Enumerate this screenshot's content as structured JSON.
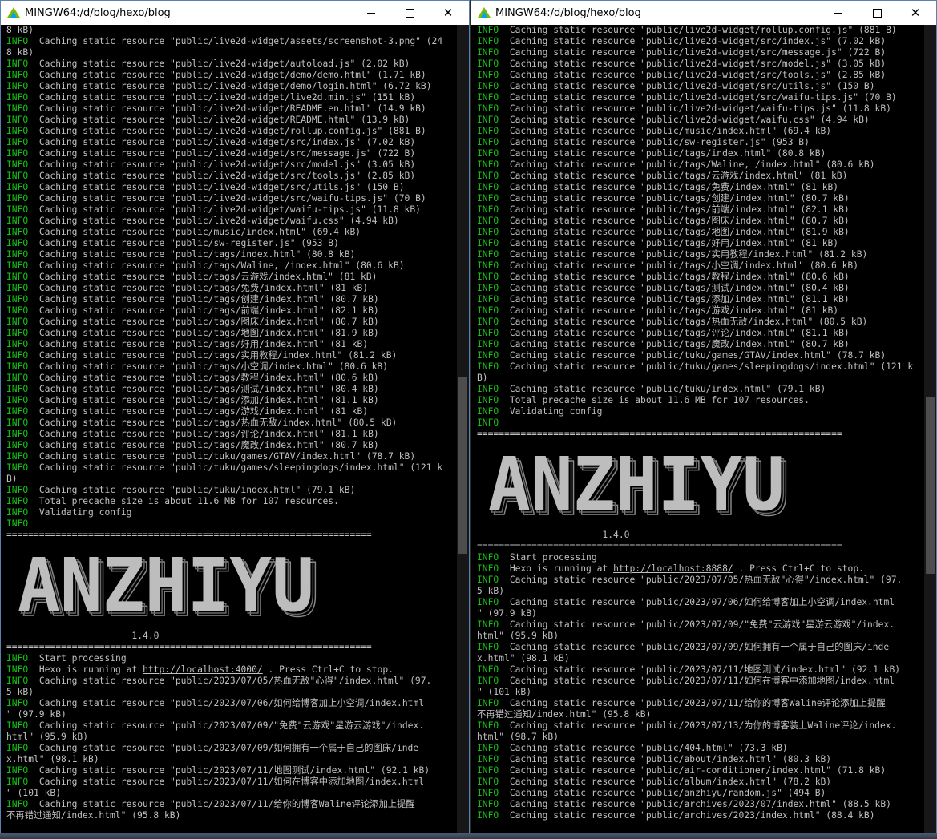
{
  "windows": [
    {
      "title": "MINGW64:/d/blog/hexo/blog",
      "lines": [
        {
          "text": "8 kB)"
        },
        {
          "level": "INFO",
          "text": "Caching static resource \"public/live2d-widget/assets/screenshot-3.png\" (24"
        },
        {
          "text": "8 kB)"
        },
        {
          "level": "INFO",
          "text": "Caching static resource \"public/live2d-widget/autoload.js\" (2.02 kB)"
        },
        {
          "level": "INFO",
          "text": "Caching static resource \"public/live2d-widget/demo/demo.html\" (1.71 kB)"
        },
        {
          "level": "INFO",
          "text": "Caching static resource \"public/live2d-widget/demo/login.html\" (6.72 kB)"
        },
        {
          "level": "INFO",
          "text": "Caching static resource \"public/live2d-widget/live2d.min.js\" (151 kB)"
        },
        {
          "level": "INFO",
          "text": "Caching static resource \"public/live2d-widget/README.en.html\" (14.9 kB)"
        },
        {
          "level": "INFO",
          "text": "Caching static resource \"public/live2d-widget/README.html\" (13.9 kB)"
        },
        {
          "level": "INFO",
          "text": "Caching static resource \"public/live2d-widget/rollup.config.js\" (881 B)"
        },
        {
          "level": "INFO",
          "text": "Caching static resource \"public/live2d-widget/src/index.js\" (7.02 kB)"
        },
        {
          "level": "INFO",
          "text": "Caching static resource \"public/live2d-widget/src/message.js\" (722 B)"
        },
        {
          "level": "INFO",
          "text": "Caching static resource \"public/live2d-widget/src/model.js\" (3.05 kB)"
        },
        {
          "level": "INFO",
          "text": "Caching static resource \"public/live2d-widget/src/tools.js\" (2.85 kB)"
        },
        {
          "level": "INFO",
          "text": "Caching static resource \"public/live2d-widget/src/utils.js\" (150 B)"
        },
        {
          "level": "INFO",
          "text": "Caching static resource \"public/live2d-widget/src/waifu-tips.js\" (70 B)"
        },
        {
          "level": "INFO",
          "text": "Caching static resource \"public/live2d-widget/waifu-tips.js\" (11.8 kB)"
        },
        {
          "level": "INFO",
          "text": "Caching static resource \"public/live2d-widget/waifu.css\" (4.94 kB)"
        },
        {
          "level": "INFO",
          "text": "Caching static resource \"public/music/index.html\" (69.4 kB)"
        },
        {
          "level": "INFO",
          "text": "Caching static resource \"public/sw-register.js\" (953 B)"
        },
        {
          "level": "INFO",
          "text": "Caching static resource \"public/tags/index.html\" (80.8 kB)"
        },
        {
          "level": "INFO",
          "text": "Caching static resource \"public/tags/Waline, /index.html\" (80.6 kB)"
        },
        {
          "level": "INFO",
          "text": "Caching static resource \"public/tags/云游戏/index.html\" (81 kB)"
        },
        {
          "level": "INFO",
          "text": "Caching static resource \"public/tags/免费/index.html\" (81 kB)"
        },
        {
          "level": "INFO",
          "text": "Caching static resource \"public/tags/创建/index.html\" (80.7 kB)"
        },
        {
          "level": "INFO",
          "text": "Caching static resource \"public/tags/前端/index.html\" (82.1 kB)"
        },
        {
          "level": "INFO",
          "text": "Caching static resource \"public/tags/图床/index.html\" (80.7 kB)"
        },
        {
          "level": "INFO",
          "text": "Caching static resource \"public/tags/地图/index.html\" (81.9 kB)"
        },
        {
          "level": "INFO",
          "text": "Caching static resource \"public/tags/好用/index.html\" (81 kB)"
        },
        {
          "level": "INFO",
          "text": "Caching static resource \"public/tags/实用教程/index.html\" (81.2 kB)"
        },
        {
          "level": "INFO",
          "text": "Caching static resource \"public/tags/小空调/index.html\" (80.6 kB)"
        },
        {
          "level": "INFO",
          "text": "Caching static resource \"public/tags/教程/index.html\" (80.6 kB)"
        },
        {
          "level": "INFO",
          "text": "Caching static resource \"public/tags/测试/index.html\" (80.4 kB)"
        },
        {
          "level": "INFO",
          "text": "Caching static resource \"public/tags/添加/index.html\" (81.1 kB)"
        },
        {
          "level": "INFO",
          "text": "Caching static resource \"public/tags/游戏/index.html\" (81 kB)"
        },
        {
          "level": "INFO",
          "text": "Caching static resource \"public/tags/热血无敌/index.html\" (80.5 kB)"
        },
        {
          "level": "INFO",
          "text": "Caching static resource \"public/tags/评论/index.html\" (81.1 kB)"
        },
        {
          "level": "INFO",
          "text": "Caching static resource \"public/tags/魔改/index.html\" (80.7 kB)"
        },
        {
          "level": "INFO",
          "text": "Caching static resource \"public/tuku/games/GTAV/index.html\" (78.7 kB)"
        },
        {
          "level": "INFO",
          "text": "Caching static resource \"public/tuku/games/sleepingdogs/index.html\" (121 k"
        },
        {
          "text": "B)"
        },
        {
          "level": "INFO",
          "text": "Caching static resource \"public/tuku/index.html\" (79.1 kB)"
        },
        {
          "level": "INFO",
          "text": "Total precache size is about 11.6 MB for 107 resources."
        },
        {
          "level": "INFO",
          "text": "Validating config"
        },
        {
          "level": "INFO",
          "text": ""
        },
        {
          "sep": "==================================================================="
        },
        {
          "banner": "ANZHIYU"
        },
        {
          "version": "                       1.4.0"
        },
        {
          "sep": "==================================================================="
        },
        {
          "level": "INFO",
          "text": "Start processing"
        },
        {
          "level": "INFO",
          "text": "Hexo is running at ",
          "url": "http://localhost:4000/",
          "after": " . Press Ctrl+C to stop."
        },
        {
          "level": "INFO",
          "text": "Caching static resource \"public/2023/07/05/热血无敌\"心得\"/index.html\" (97."
        },
        {
          "text": "5 kB)"
        },
        {
          "level": "INFO",
          "text": "Caching static resource \"public/2023/07/06/如何给博客加上小空调/index.html"
        },
        {
          "text": "\" (97.9 kB)"
        },
        {
          "level": "INFO",
          "text": "Caching static resource \"public/2023/07/09/\"免费\"云游戏\"星游云游戏\"/index."
        },
        {
          "text": "html\" (95.9 kB)"
        },
        {
          "level": "INFO",
          "text": "Caching static resource \"public/2023/07/09/如何拥有一个属于自己的图床/inde"
        },
        {
          "text": "x.html\" (98.1 kB)"
        },
        {
          "level": "INFO",
          "text": "Caching static resource \"public/2023/07/11/地图测试/index.html\" (92.1 kB)"
        },
        {
          "level": "INFO",
          "text": "Caching static resource \"public/2023/07/11/如何在博客中添加地图/index.html"
        },
        {
          "text": "\" (101 kB)"
        },
        {
          "level": "INFO",
          "text": "Caching static resource \"public/2023/07/11/给你的博客Waline评论添加上提醒"
        },
        {
          "text": "不再错过通知/index.html\" (95.8 kB)"
        }
      ]
    },
    {
      "title": "MINGW64:/d/blog/hexo/blog",
      "lines": [
        {
          "level": "INFO",
          "text": "Caching static resource \"public/live2d-widget/rollup.config.js\" (881 B)"
        },
        {
          "level": "INFO",
          "text": "Caching static resource \"public/live2d-widget/src/index.js\" (7.02 kB)"
        },
        {
          "level": "INFO",
          "text": "Caching static resource \"public/live2d-widget/src/message.js\" (722 B)"
        },
        {
          "level": "INFO",
          "text": "Caching static resource \"public/live2d-widget/src/model.js\" (3.05 kB)"
        },
        {
          "level": "INFO",
          "text": "Caching static resource \"public/live2d-widget/src/tools.js\" (2.85 kB)"
        },
        {
          "level": "INFO",
          "text": "Caching static resource \"public/live2d-widget/src/utils.js\" (150 B)"
        },
        {
          "level": "INFO",
          "text": "Caching static resource \"public/live2d-widget/src/waifu-tips.js\" (70 B)"
        },
        {
          "level": "INFO",
          "text": "Caching static resource \"public/live2d-widget/waifu-tips.js\" (11.8 kB)"
        },
        {
          "level": "INFO",
          "text": "Caching static resource \"public/live2d-widget/waifu.css\" (4.94 kB)"
        },
        {
          "level": "INFO",
          "text": "Caching static resource \"public/music/index.html\" (69.4 kB)"
        },
        {
          "level": "INFO",
          "text": "Caching static resource \"public/sw-register.js\" (953 B)"
        },
        {
          "level": "INFO",
          "text": "Caching static resource \"public/tags/index.html\" (80.8 kB)"
        },
        {
          "level": "INFO",
          "text": "Caching static resource \"public/tags/Waline, /index.html\" (80.6 kB)"
        },
        {
          "level": "INFO",
          "text": "Caching static resource \"public/tags/云游戏/index.html\" (81 kB)"
        },
        {
          "level": "INFO",
          "text": "Caching static resource \"public/tags/免费/index.html\" (81 kB)"
        },
        {
          "level": "INFO",
          "text": "Caching static resource \"public/tags/创建/index.html\" (80.7 kB)"
        },
        {
          "level": "INFO",
          "text": "Caching static resource \"public/tags/前端/index.html\" (82.1 kB)"
        },
        {
          "level": "INFO",
          "text": "Caching static resource \"public/tags/图床/index.html\" (80.7 kB)"
        },
        {
          "level": "INFO",
          "text": "Caching static resource \"public/tags/地图/index.html\" (81.9 kB)"
        },
        {
          "level": "INFO",
          "text": "Caching static resource \"public/tags/好用/index.html\" (81 kB)"
        },
        {
          "level": "INFO",
          "text": "Caching static resource \"public/tags/实用教程/index.html\" (81.2 kB)"
        },
        {
          "level": "INFO",
          "text": "Caching static resource \"public/tags/小空调/index.html\" (80.6 kB)"
        },
        {
          "level": "INFO",
          "text": "Caching static resource \"public/tags/教程/index.html\" (80.6 kB)"
        },
        {
          "level": "INFO",
          "text": "Caching static resource \"public/tags/测试/index.html\" (80.4 kB)"
        },
        {
          "level": "INFO",
          "text": "Caching static resource \"public/tags/添加/index.html\" (81.1 kB)"
        },
        {
          "level": "INFO",
          "text": "Caching static resource \"public/tags/游戏/index.html\" (81 kB)"
        },
        {
          "level": "INFO",
          "text": "Caching static resource \"public/tags/热血无敌/index.html\" (80.5 kB)"
        },
        {
          "level": "INFO",
          "text": "Caching static resource \"public/tags/评论/index.html\" (81.1 kB)"
        },
        {
          "level": "INFO",
          "text": "Caching static resource \"public/tags/魔改/index.html\" (80.7 kB)"
        },
        {
          "level": "INFO",
          "text": "Caching static resource \"public/tuku/games/GTAV/index.html\" (78.7 kB)"
        },
        {
          "level": "INFO",
          "text": "Caching static resource \"public/tuku/games/sleepingdogs/index.html\" (121 k"
        },
        {
          "text": "B)"
        },
        {
          "level": "INFO",
          "text": "Caching static resource \"public/tuku/index.html\" (79.1 kB)"
        },
        {
          "level": "INFO",
          "text": "Total precache size is about 11.6 MB for 107 resources."
        },
        {
          "level": "INFO",
          "text": "Validating config"
        },
        {
          "level": "INFO",
          "text": ""
        },
        {
          "sep": "==================================================================="
        },
        {
          "banner": "ANZHIYU"
        },
        {
          "version": "                       1.4.0"
        },
        {
          "sep": "==================================================================="
        },
        {
          "level": "INFO",
          "text": "Start processing"
        },
        {
          "level": "INFO",
          "text": "Hexo is running at ",
          "url": "http://localhost:8888/",
          "after": " . Press Ctrl+C to stop."
        },
        {
          "level": "INFO",
          "text": "Caching static resource \"public/2023/07/05/热血无敌\"心得\"/index.html\" (97."
        },
        {
          "text": "5 kB)"
        },
        {
          "level": "INFO",
          "text": "Caching static resource \"public/2023/07/06/如何给博客加上小空调/index.html"
        },
        {
          "text": "\" (97.9 kB)"
        },
        {
          "level": "INFO",
          "text": "Caching static resource \"public/2023/07/09/\"免费\"云游戏\"星游云游戏\"/index."
        },
        {
          "text": "html\" (95.9 kB)"
        },
        {
          "level": "INFO",
          "text": "Caching static resource \"public/2023/07/09/如何拥有一个属于自己的图床/inde"
        },
        {
          "text": "x.html\" (98.1 kB)"
        },
        {
          "level": "INFO",
          "text": "Caching static resource \"public/2023/07/11/地图测试/index.html\" (92.1 kB)"
        },
        {
          "level": "INFO",
          "text": "Caching static resource \"public/2023/07/11/如何在博客中添加地图/index.html"
        },
        {
          "text": "\" (101 kB)"
        },
        {
          "level": "INFO",
          "text": "Caching static resource \"public/2023/07/11/给你的博客Waline评论添加上提醒"
        },
        {
          "text": "不再错过通知/index.html\" (95.8 kB)"
        },
        {
          "level": "INFO",
          "text": "Caching static resource \"public/2023/07/13/为你的博客装上Waline评论/index."
        },
        {
          "text": "html\" (98.7 kB)"
        },
        {
          "level": "INFO",
          "text": "Caching static resource \"public/404.html\" (73.3 kB)"
        },
        {
          "level": "INFO",
          "text": "Caching static resource \"public/about/index.html\" (80.3 kB)"
        },
        {
          "level": "INFO",
          "text": "Caching static resource \"public/air-conditioner/index.html\" (71.8 kB)"
        },
        {
          "level": "INFO",
          "text": "Caching static resource \"public/album/index.html\" (78.2 kB)"
        },
        {
          "level": "INFO",
          "text": "Caching static resource \"public/anzhiyu/random.js\" (494 B)"
        },
        {
          "level": "INFO",
          "text": "Caching static resource \"public/archives/2023/07/index.html\" (88.5 kB)"
        },
        {
          "level": "INFO",
          "text": "Caching static resource \"public/archives/2023/index.html\" (88.4 kB)"
        }
      ]
    }
  ],
  "colors": {
    "info": "#13c313",
    "text": "#c0c0c0",
    "background": "#000000",
    "titlebar": "#ffffff"
  },
  "icons": [
    "mingw64-app-icon",
    "minimize-icon",
    "maximize-icon",
    "close-icon"
  ]
}
